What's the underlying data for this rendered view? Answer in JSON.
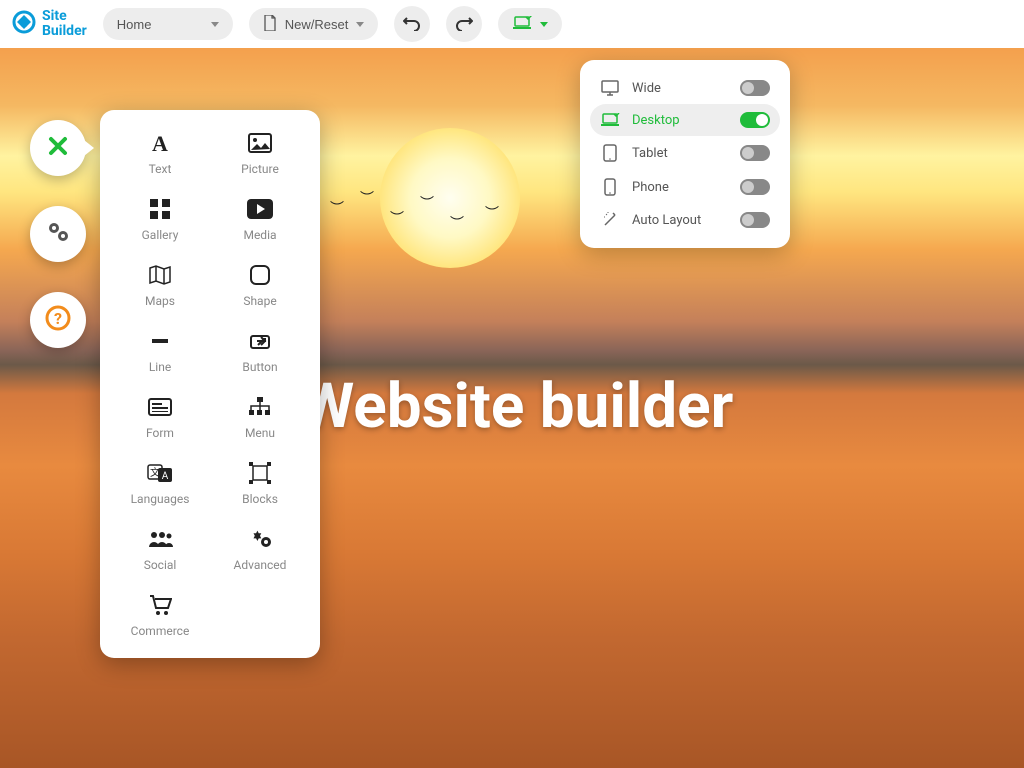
{
  "logo": {
    "line1": "Site",
    "line2": "Builder"
  },
  "toolbar": {
    "page_selector": "Home",
    "new_reset": "New/Reset"
  },
  "elements": [
    {
      "name": "text",
      "label": "Text"
    },
    {
      "name": "picture",
      "label": "Picture"
    },
    {
      "name": "gallery",
      "label": "Gallery"
    },
    {
      "name": "media",
      "label": "Media"
    },
    {
      "name": "maps",
      "label": "Maps"
    },
    {
      "name": "shape",
      "label": "Shape"
    },
    {
      "name": "line",
      "label": "Line"
    },
    {
      "name": "button",
      "label": "Button"
    },
    {
      "name": "form",
      "label": "Form"
    },
    {
      "name": "menu",
      "label": "Menu"
    },
    {
      "name": "languages",
      "label": "Languages"
    },
    {
      "name": "blocks",
      "label": "Blocks"
    },
    {
      "name": "social",
      "label": "Social"
    },
    {
      "name": "advanced",
      "label": "Advanced"
    },
    {
      "name": "commerce",
      "label": "Commerce"
    }
  ],
  "viewport_menu": [
    {
      "name": "wide",
      "label": "Wide",
      "active": false,
      "on": false
    },
    {
      "name": "desktop",
      "label": "Desktop",
      "active": true,
      "on": true
    },
    {
      "name": "tablet",
      "label": "Tablet",
      "active": false,
      "on": false
    },
    {
      "name": "phone",
      "label": "Phone",
      "active": false,
      "on": false
    },
    {
      "name": "auto",
      "label": "Auto Layout",
      "active": false,
      "on": false
    }
  ],
  "hero": {
    "title": "Website builder"
  },
  "colors": {
    "brand": "#0a9cd9",
    "accent_green": "#1fbc3a",
    "accent_orange": "#f28c1c"
  }
}
